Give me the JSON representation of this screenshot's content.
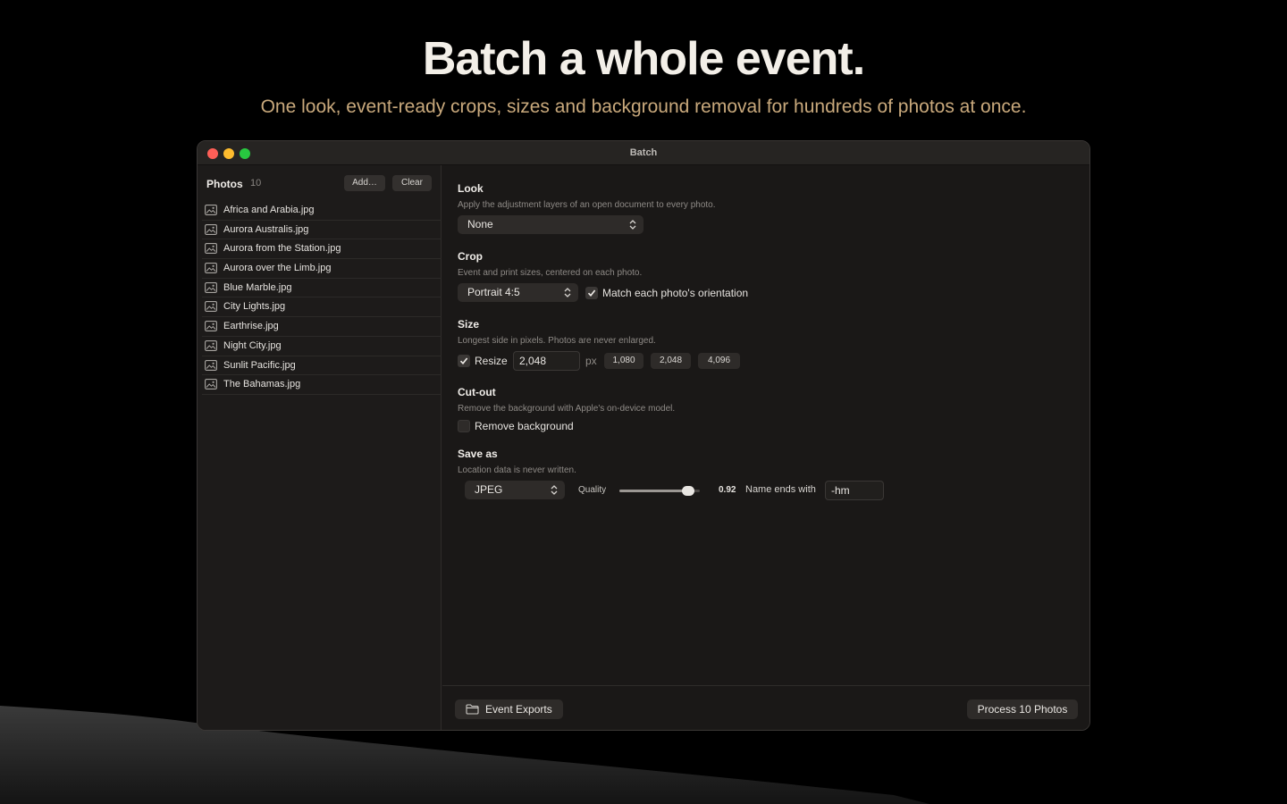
{
  "hero": {
    "title": "Batch a whole event.",
    "subtitle": "One look, event-ready crops, sizes and background removal for hundreds of photos at once."
  },
  "window": {
    "title": "Batch"
  },
  "sidebar": {
    "title": "Photos",
    "count": "10",
    "add_label": "Add…",
    "clear_label": "Clear",
    "files": [
      "Africa and Arabia.jpg",
      "Aurora Australis.jpg",
      "Aurora from the Station.jpg",
      "Aurora over the Limb.jpg",
      "Blue Marble.jpg",
      "City Lights.jpg",
      "Earthrise.jpg",
      "Night City.jpg",
      "Sunlit Pacific.jpg",
      "The Bahamas.jpg"
    ]
  },
  "look": {
    "title": "Look",
    "description": "Apply the adjustment layers of an open document to every photo.",
    "selected": "None"
  },
  "crop": {
    "title": "Crop",
    "description": "Event and print sizes, centered on each photo.",
    "selected": "Portrait 4:5",
    "match_label": "Match each photo's orientation",
    "match_checked": true
  },
  "size": {
    "title": "Size",
    "description": "Longest side in pixels. Photos are never enlarged.",
    "resize_label": "Resize",
    "resize_checked": true,
    "value": "2,048",
    "unit": "px",
    "presets": [
      "1,080",
      "2,048",
      "4,096"
    ]
  },
  "cutout": {
    "title": "Cut-out",
    "description": "Remove the background with Apple's on-device model.",
    "remove_label": "Remove background",
    "remove_checked": false
  },
  "save": {
    "title": "Save as",
    "description": "Location data is never written.",
    "format": "JPEG",
    "quality_label": "Quality",
    "quality_value": "0.92",
    "quality_fraction": 0.92,
    "suffix_label": "Name ends with",
    "suffix_value": "-hm"
  },
  "footer": {
    "folder_label": "Event Exports",
    "process_label": "Process 10 Photos"
  },
  "icons": {
    "folder": "folder-icon",
    "photo": "photo-icon",
    "updown": "chevron-updown-icon",
    "check": "checkmark-icon"
  }
}
